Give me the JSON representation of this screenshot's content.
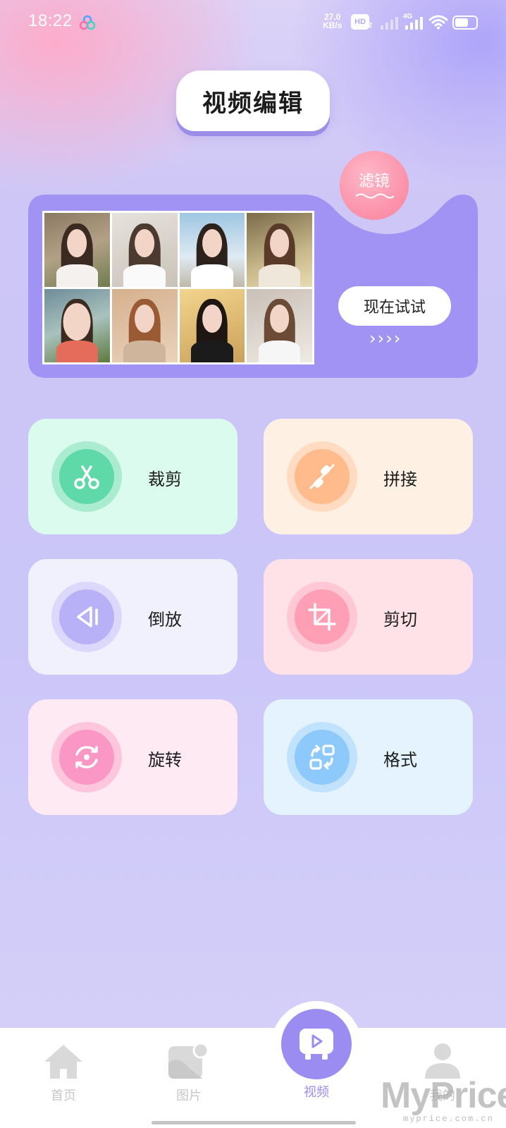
{
  "status_bar": {
    "time": "18:22",
    "net_speed_value": "27.0",
    "net_speed_unit": "KB/s",
    "hd_label": "HD",
    "hd_sub": "2",
    "network_type": "4G"
  },
  "header": {
    "title": "视频编辑"
  },
  "banner": {
    "badge_label": "滤镜",
    "try_button_label": "现在试试",
    "arrows": "››››"
  },
  "tools": [
    {
      "label": "裁剪",
      "icon": "scissors-icon"
    },
    {
      "label": "拼接",
      "icon": "link-icon"
    },
    {
      "label": "倒放",
      "icon": "reverse-play-icon"
    },
    {
      "label": "剪切",
      "icon": "crop-icon"
    },
    {
      "label": "旋转",
      "icon": "rotate-icon"
    },
    {
      "label": "格式",
      "icon": "format-convert-icon"
    }
  ],
  "bottom_nav": {
    "items": [
      {
        "label": "首页",
        "icon": "home-icon"
      },
      {
        "label": "图片",
        "icon": "image-icon"
      },
      {
        "label": "视频",
        "icon": "video-icon",
        "active": true
      },
      {
        "label": "我的",
        "icon": "user-icon"
      }
    ],
    "active_color": "#9b8cf1",
    "inactive_color": "#c7c7c7"
  },
  "watermark": {
    "text": "MyPrice",
    "sub": "myprice.com.cn"
  }
}
